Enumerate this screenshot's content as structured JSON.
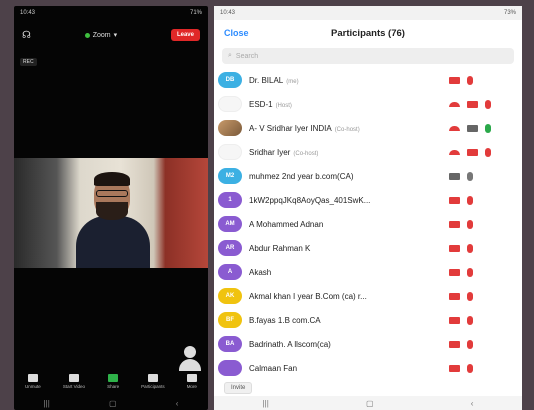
{
  "left": {
    "status_time": "10:43",
    "status_right": "71%",
    "zoom_label": "Zoom",
    "leave_label": "Leave",
    "rec_label": "REC",
    "toolbar": [
      "Unmute",
      "Start Video",
      "Share",
      "Participants",
      "More"
    ]
  },
  "right": {
    "status_time": "10:43",
    "status_right": "73%",
    "close_label": "Close",
    "title": "Participants (76)",
    "search_placeholder": "Search",
    "invite_label": "Invite",
    "participants": [
      {
        "avatar": "DB",
        "name": "Dr. BILAL",
        "tag": "(me)",
        "avatar_color": "#3cb0e3",
        "av_type": "text"
      },
      {
        "avatar": "",
        "name": "ESD-1",
        "tag": "(Host)",
        "avatar_color": "#f6f6f6",
        "av_type": "logo"
      },
      {
        "avatar": "",
        "name": "A- V Sridhar Iyer INDIA",
        "tag": "(Co-host)",
        "avatar_color": "#c89a6a",
        "av_type": "photo"
      },
      {
        "avatar": "",
        "name": "Sridhar Iyer",
        "tag": "(Co-host)",
        "avatar_color": "#f6f6f6",
        "av_type": "logo"
      },
      {
        "avatar": "M2",
        "name": "muhmez 2nd year b.com(CA)",
        "tag": "",
        "avatar_color": "#3cb0e3",
        "av_type": "text"
      },
      {
        "avatar": "1",
        "name": "1kW2ppqJKq8AoyQas_401SwK...",
        "tag": "",
        "avatar_color": "#8a5bd1",
        "av_type": "text"
      },
      {
        "avatar": "AM",
        "name": "A Mohammed Adnan",
        "tag": "",
        "avatar_color": "#8a5bd1",
        "av_type": "text"
      },
      {
        "avatar": "AR",
        "name": "Abdur Rahman K",
        "tag": "",
        "avatar_color": "#8a5bd1",
        "av_type": "text"
      },
      {
        "avatar": "A",
        "name": "Akash",
        "tag": "",
        "avatar_color": "#8a5bd1",
        "av_type": "text"
      },
      {
        "avatar": "AK",
        "name": "Akmal khan I year B.Com (ca) r...",
        "tag": "",
        "avatar_color": "#f0c30f",
        "av_type": "text"
      },
      {
        "avatar": "BF",
        "name": "B.fayas 1.B com.CA",
        "tag": "",
        "avatar_color": "#f0c30f",
        "av_type": "text"
      },
      {
        "avatar": "BA",
        "name": "Badrinath. A llscom(ca)",
        "tag": "",
        "avatar_color": "#8a5bd1",
        "av_type": "text"
      },
      {
        "avatar": "",
        "name": "Calmaan Fan",
        "tag": "",
        "avatar_color": "#8a5bd1",
        "av_type": "text"
      }
    ]
  }
}
